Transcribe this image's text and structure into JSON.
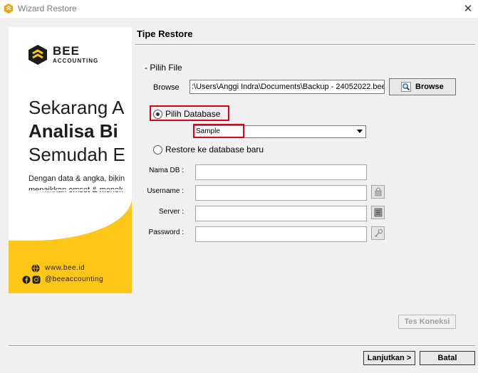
{
  "window": {
    "title": "Wizard Restore",
    "close_glyph": "✕"
  },
  "banner": {
    "brand_name": "BEE",
    "brand_sub": "ACCOUNTING",
    "headline_1": "Sekarang A",
    "headline_2": "Analisa Bi",
    "headline_3": "Semudah E",
    "body_1": "Dengan data & angka, bikin",
    "body_2": "menaikkan omset & menek",
    "website": "www.bee.id",
    "social": "@beeaccounting",
    "accent_color": "#fec718"
  },
  "page": {
    "section_title": "Tipe Restore"
  },
  "file": {
    "group_label": "- Pilih File",
    "browse_label": "Browse",
    "path_value": ":\\Users\\Anggi Indra\\Documents\\Backup - 24052022.bee",
    "browse_button": "Browse"
  },
  "database": {
    "option_select_label": "Pilih Database",
    "option_select_checked": true,
    "selected_database": "Sample",
    "option_new_label": "Restore ke database baru",
    "option_new_checked": false
  },
  "form": {
    "nama_db_label": "Nama DB :",
    "username_label": "Username :",
    "server_label": "Server :",
    "password_label": "Password :",
    "nama_db_value": "",
    "username_value": "",
    "server_value": "",
    "password_value": ""
  },
  "buttons": {
    "test_connection": "Tes Koneksi",
    "next": "Lanjutkan >",
    "cancel": "Batal"
  },
  "highlight_color": "#e0001a"
}
